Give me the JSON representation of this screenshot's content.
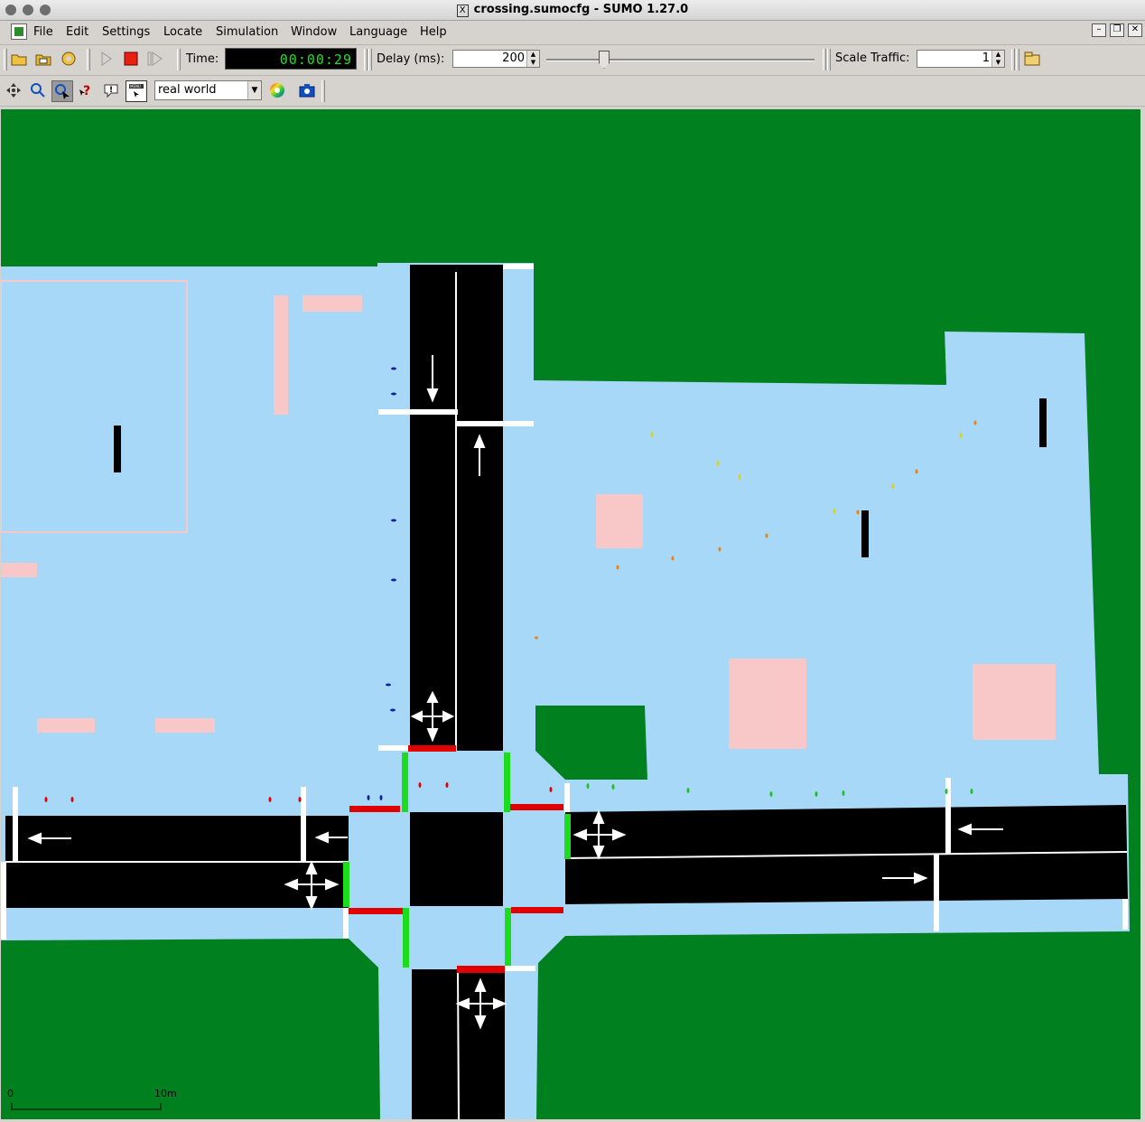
{
  "window": {
    "title": "crossing.sumocfg - SUMO 1.27.0",
    "title_icon": "X"
  },
  "menu": {
    "items": [
      "File",
      "Edit",
      "Settings",
      "Locate",
      "Simulation",
      "Window",
      "Language",
      "Help"
    ]
  },
  "toolbar": {
    "time_label": "Time:",
    "time_value": "00:00:29",
    "delay_label": "Delay (ms):",
    "delay_value": "200",
    "scale_label": "Scale Traffic:",
    "scale_value": "1",
    "delay_slider_fraction": 0.2
  },
  "view_toolbar": {
    "scheme_value": "real world"
  },
  "canvas": {
    "scale_start": "0",
    "scale_end": "10m",
    "colors": {
      "grass": "#00801f",
      "walkway": "#a8d8f8",
      "road": "#000000",
      "building": "#f8c8c8",
      "signal_red": "#e00000",
      "signal_green": "#1cdc1c",
      "marking": "#ffffff"
    }
  }
}
